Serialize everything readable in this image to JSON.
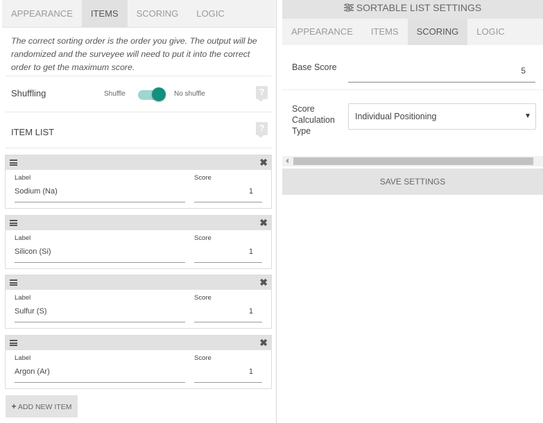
{
  "left_panel": {
    "tabs": [
      {
        "label": "APPEARANCE",
        "active": false
      },
      {
        "label": "ITEMS",
        "active": true
      },
      {
        "label": "SCORING",
        "active": false
      },
      {
        "label": "LOGIC",
        "active": false
      }
    ],
    "description": "The correct sorting order is the order you give. The output will be randomized and the surveyee will need to put it into the correct order to get the maximum score.",
    "shuffling": {
      "label": "Shuffling",
      "option_left": "Shuffle",
      "option_right": "No shuffle",
      "selected": "No shuffle"
    },
    "item_list_label": "ITEM LIST",
    "help_icon": "?",
    "items": [
      {
        "label_caption": "Label",
        "label_value": "Sodium (Na)",
        "score_caption": "Score",
        "score_value": "1"
      },
      {
        "label_caption": "Label",
        "label_value": "Silicon (Si)",
        "score_caption": "Score",
        "score_value": "1"
      },
      {
        "label_caption": "Label",
        "label_value": "Sulfur (S)",
        "score_caption": "Score",
        "score_value": "1"
      },
      {
        "label_caption": "Label",
        "label_value": "Argon (Ar)",
        "score_caption": "Score",
        "score_value": "1"
      }
    ],
    "add_button": {
      "icon": "+",
      "label": "ADD NEW ITEM"
    }
  },
  "right_panel": {
    "title": "SORTABLE LIST SETTINGS",
    "title_icon": "sliders-icon",
    "tabs": [
      {
        "label": "APPEARANCE",
        "active": false
      },
      {
        "label": "ITEMS",
        "active": false
      },
      {
        "label": "SCORING",
        "active": true
      },
      {
        "label": "LOGIC",
        "active": false
      }
    ],
    "base_score": {
      "label": "Base Score",
      "value": "5"
    },
    "score_calc": {
      "label": "Score Calculation Type",
      "value": "Individual Positioning"
    },
    "save_button": "SAVE SETTINGS"
  },
  "colors": {
    "toggle_knob": "#15907f",
    "toggle_track": "#9fd6cf",
    "tab_bar": "#f2f2f2",
    "active_tab": "#e1e1e1"
  }
}
